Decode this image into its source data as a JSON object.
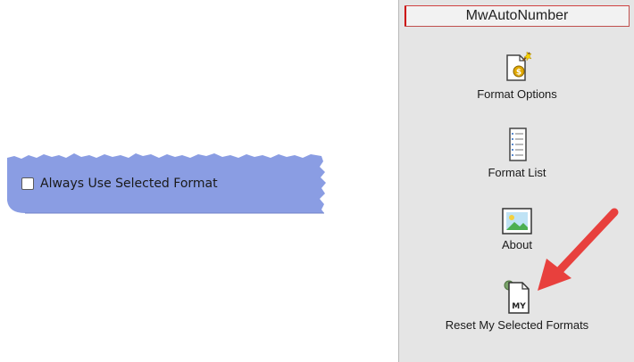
{
  "left_panel": {
    "checkbox_label": "Always Use Selected Format",
    "checked": false,
    "bg_color": "#8a9de3"
  },
  "ribbon": {
    "title": "MwAutoNumber",
    "items": [
      {
        "label": "Format Options",
        "icon": "format-options-icon"
      },
      {
        "label": "Format List",
        "icon": "format-list-icon"
      },
      {
        "label": "About",
        "icon": "about-image-icon"
      },
      {
        "label": "Reset My Selected Formats",
        "icon": "reset-my-formats-icon"
      }
    ]
  },
  "annotation": {
    "arrow_color": "#e8403d",
    "points_to": "Reset My Selected Formats"
  }
}
